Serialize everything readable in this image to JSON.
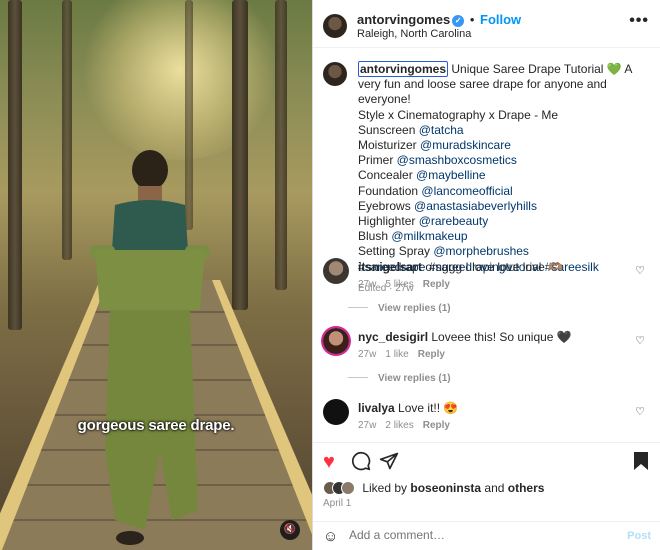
{
  "media": {
    "caption_overlay": "gorgeous saree drape.",
    "mute_icon": "speaker-mute-icon"
  },
  "header": {
    "username": "antorvingomes",
    "follow_label": "Follow",
    "location": "Raleigh, North Carolina",
    "separator": "•"
  },
  "post": {
    "username": "antorvingomes",
    "lines": [
      {
        "text": "Unique Saree Drape Tutorial 💚 A very fun and loose saree drape for anyone and everyone!"
      },
      {
        "text": "Style x Cinematography x Drape - Me"
      },
      {
        "label": "Sunscreen ",
        "tag": "@tatcha"
      },
      {
        "label": "Moisturizer ",
        "tag": "@muradskincare"
      },
      {
        "label": "Primer ",
        "tag": "@smashboxcosmetics"
      },
      {
        "label": "Concealer ",
        "tag": "@maybelline"
      },
      {
        "label": "Foundation ",
        "tag": "@lancomeofficial"
      },
      {
        "label": "Eyebrows ",
        "tag": "@anastasiabeverlyhills"
      },
      {
        "label": "Highlighter ",
        "tag": "@rarebeauty"
      },
      {
        "label": "Blush ",
        "tag": "@milkmakeup"
      },
      {
        "label": "Setting Spray ",
        "tag": "@morphebrushes"
      }
    ],
    "hashtags": "#sareedrape #sareedrapingtutorial #sareesilk",
    "meta": "Edited · 27w"
  },
  "comments": [
    {
      "username": "itsnigelsart",
      "text": "omggg I love love love 🫶🏽",
      "time": "27w",
      "likes": "5 likes",
      "reply": "Reply",
      "view_replies": "View replies (1)"
    },
    {
      "username": "nyc_desigirl",
      "text": "Loveee this! So unique 🖤",
      "time": "27w",
      "likes": "1 like",
      "reply": "Reply",
      "view_replies": "View replies (1)"
    },
    {
      "username": "livalya",
      "text": "Love it!! 😍",
      "time": "27w",
      "likes": "2 likes",
      "reply": "Reply"
    }
  ],
  "actions": {
    "liked_by_prefix": "Liked by ",
    "liked_by_user": "boseoninsta",
    "liked_by_and": " and ",
    "liked_by_others": "others",
    "date": "April 1"
  },
  "add_comment": {
    "placeholder": "Add a comment…",
    "post_label": "Post"
  },
  "colors": {
    "accent": "#0095f6",
    "like_red": "#ff3040",
    "tag_blue": "#00376b"
  }
}
